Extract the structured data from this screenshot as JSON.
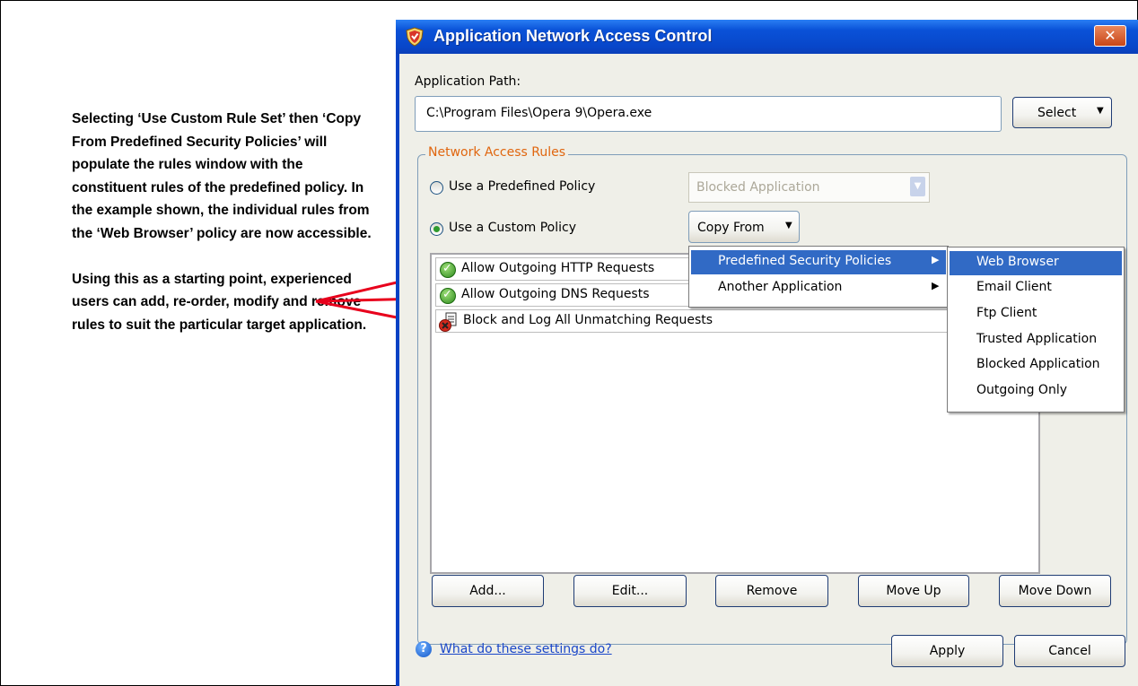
{
  "annotation": {
    "paragraph1": "Selecting ‘Use Custom Rule Set’ then ‘Copy From Predefined Security Policies’ will populate the rules window with the constituent rules of the predefined policy. In the example shown, the individual rules from the ‘Web Browser’ policy are now accessible.",
    "paragraph2": "Using this as a starting point, experienced users can add, re-order, modify and remove rules to suit the particular target application."
  },
  "dialog": {
    "title": "Application Network Access Control",
    "close_label": "✕",
    "app_path_label": "Application Path:",
    "app_path_value": "C:\\Program Files\\Opera 9\\Opera.exe",
    "select_button": "Select",
    "group_title": "Network Access Rules",
    "predefined_radio": "Use a Predefined Policy",
    "predefined_value": "Blocked Application",
    "custom_radio": "Use a Custom Policy",
    "copy_from_button": "Copy From",
    "rules": [
      {
        "label": "Allow Outgoing HTTP Requests",
        "icon": "allow-icon"
      },
      {
        "label": "Allow Outgoing DNS Requests",
        "icon": "allow-icon"
      },
      {
        "label": "Block and Log All Unmatching Requests",
        "icon": "block-log-icon"
      }
    ],
    "copy_menu": [
      {
        "label": "Predefined Security Policies",
        "highlighted": true
      },
      {
        "label": "Another Application",
        "highlighted": false
      }
    ],
    "policy_menu": [
      {
        "label": "Web Browser",
        "highlighted": true
      },
      {
        "label": "Email Client"
      },
      {
        "label": "Ftp Client"
      },
      {
        "label": "Trusted Application"
      },
      {
        "label": "Blocked Application"
      },
      {
        "label": "Outgoing Only"
      }
    ],
    "buttons": {
      "add": "Add...",
      "edit": "Edit...",
      "remove": "Remove",
      "move_up": "Move Up",
      "move_down": "Move Down",
      "apply": "Apply",
      "cancel": "Cancel"
    },
    "help_link": "What do these settings do?"
  },
  "colors": {
    "titlebar": "#0a52d8",
    "menu_highlight": "#316ac5",
    "group_title": "#e0660f",
    "arrow": "#e8001c",
    "link": "#1a47c9"
  }
}
